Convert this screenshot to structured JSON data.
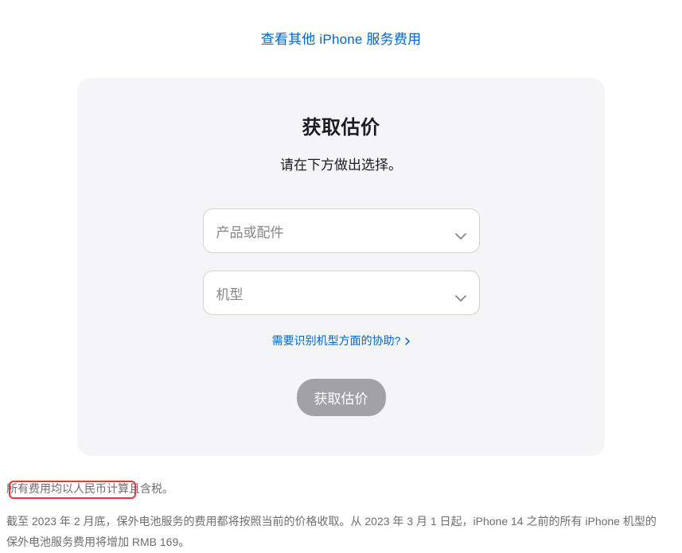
{
  "topLink": "查看其他 iPhone 服务费用",
  "card": {
    "title": "获取估价",
    "subtitle": "请在下方做出选择。",
    "select1Placeholder": "产品或配件",
    "select2Placeholder": "机型",
    "helpLink": "需要识别机型方面的协助?",
    "submitButton": "获取估价"
  },
  "footer": {
    "line1": "所有费用均以人民币计算且含税。",
    "line2_part1": "截至 2023 年 2 月底，保外电池服务的费用都将按照当前的价格收取。从 2023 年 3 月 1 日起，iPhone 14 之前的所有 iPhone 机型的保外电池服务",
    "line2_highlight": "费用将增加 RMB 169。"
  }
}
